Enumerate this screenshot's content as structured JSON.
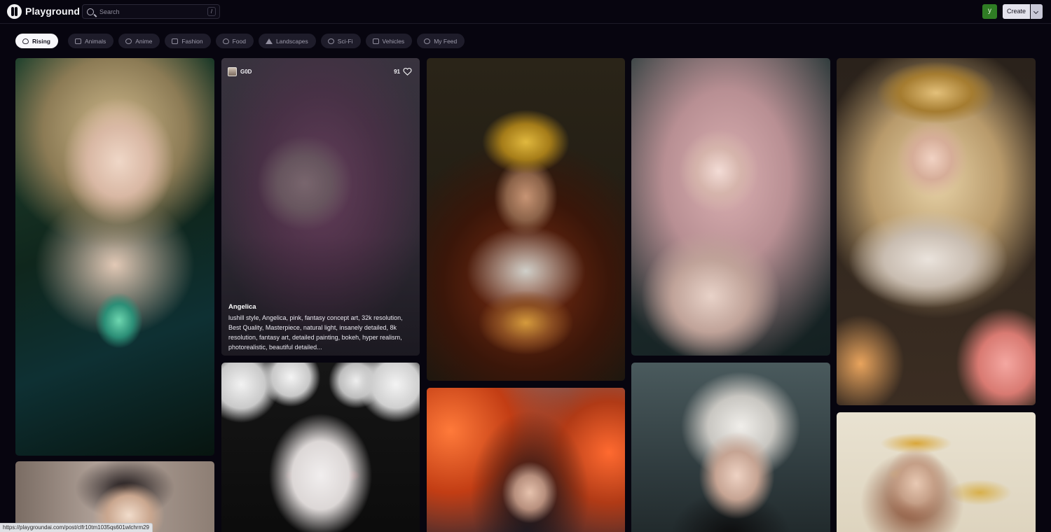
{
  "header": {
    "app_name": "Playground",
    "search_placeholder": "Search",
    "search_shortcut": "/",
    "user_initial": "y",
    "create_label": "Create"
  },
  "filters": [
    {
      "label": "Rising",
      "icon": "flame-icon",
      "active": true
    },
    {
      "label": "Animals",
      "icon": "animals-icon",
      "active": false
    },
    {
      "label": "Anime",
      "icon": "anime-icon",
      "active": false
    },
    {
      "label": "Fashion",
      "icon": "fashion-icon",
      "active": false
    },
    {
      "label": "Food",
      "icon": "food-icon",
      "active": false
    },
    {
      "label": "Landscapes",
      "icon": "landscape-icon",
      "active": false
    },
    {
      "label": "Sci-Fi",
      "icon": "scifi-icon",
      "active": false
    },
    {
      "label": "Vehicles",
      "icon": "vehicle-icon",
      "active": false
    },
    {
      "label": "My Feed",
      "icon": "user-icon",
      "active": false
    }
  ],
  "hovered_post": {
    "username": "G0D",
    "likes": "91",
    "title": "Angelica",
    "prompt": "lushill style, Angelica, pink, fantasy concept art, 32k resolution, Best Quality, Masterpiece, natural light, insanely detailed, 8k resolution, fantasy art, detailed painting, bokeh, hyper realism, photorealistic, beautiful detailed..."
  },
  "status_bar": {
    "url": "https://playgroundai.com/post/clfr10tm1035qs601wlchrm29"
  },
  "colors": {
    "background": "#07050f",
    "chip_background": "#1e1c2a",
    "chip_active": "#f7f7fa",
    "avatar_green": "#2f7d24"
  }
}
